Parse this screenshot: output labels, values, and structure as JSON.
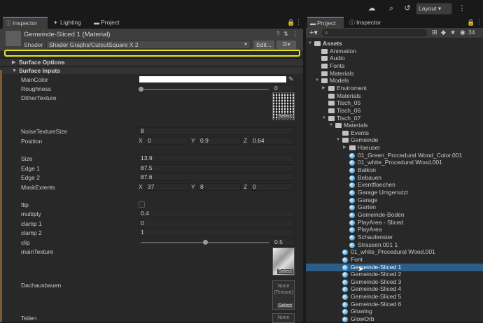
{
  "topbar": {
    "icons": [
      "cloud-icon",
      "search-icon",
      "history-icon"
    ],
    "layout_label": "Layout ▾",
    "more_icon": "more-icon"
  },
  "left": {
    "tabs": [
      {
        "label": "Inspector",
        "icon": "info-icon",
        "active": true
      },
      {
        "label": "Lighting",
        "icon": "bulb-icon",
        "active": false
      },
      {
        "label": "Project",
        "icon": "folder-icon",
        "active": false
      }
    ],
    "material_title": "Gemeinde-Sliced 1 (Material)",
    "shader_label": "Shader",
    "shader_value": "Shader Graphs/CutoutSquare X 2",
    "edit_label": "Edit...",
    "sections": {
      "surface_options": "Surface Options",
      "surface_inputs": "Surface Inputs"
    },
    "props": {
      "main_color": "MainColor",
      "roughness": "Roughness",
      "roughness_value": "0",
      "roughness_level": 0,
      "dither_texture": "DitherTexture",
      "select": "Select",
      "noise_texture_size": "NoiseTextureSize",
      "noise_texture_size_value": "8",
      "position": "Position",
      "position_x": "0",
      "position_y": "0.9",
      "position_z": "0.64",
      "size": "Size",
      "size_value": "13.9",
      "edge1": "Edge 1",
      "edge1_value": "87.5",
      "edge2": "Edge 2",
      "edge2_value": "87.6",
      "mask_extents": "MaskExtents",
      "mask_x": "37",
      "mask_y": "8",
      "mask_z": "0",
      "flip": "flip",
      "multiply": "multiply",
      "multiply_value": "0.4",
      "clamp1": "clamp 1",
      "clamp1_value": "0",
      "clamp2": "clamp 2",
      "clamp2_value": "1",
      "clip": "clip",
      "clip_value": "0.5",
      "clip_level": 0.5,
      "main_texture": "mainTexture",
      "dachausbauen": "Dachausbauen",
      "none_texture": "None\n(Texture)",
      "teilen": "Teilen",
      "none_short": "None"
    },
    "axes": {
      "x": "X",
      "y": "Y",
      "z": "Z"
    }
  },
  "right": {
    "tabs": [
      {
        "label": "Project",
        "icon": "folder-icon",
        "active": true
      },
      {
        "label": "Inspector",
        "icon": "info-icon",
        "active": false
      }
    ],
    "hidden_count": "34",
    "tree": [
      {
        "label": "Assets",
        "type": "folder",
        "depth": 0,
        "open": true,
        "bold": true
      },
      {
        "label": "Animation",
        "type": "folder",
        "depth": 1
      },
      {
        "label": "Audio",
        "type": "folder",
        "depth": 1
      },
      {
        "label": "Fonts",
        "type": "folder",
        "depth": 1
      },
      {
        "label": "Materials",
        "type": "folder",
        "depth": 1
      },
      {
        "label": "Models",
        "type": "folder",
        "depth": 1,
        "open": true
      },
      {
        "label": "Enviroment",
        "type": "folder",
        "depth": 2,
        "arrow": true
      },
      {
        "label": "Materials",
        "type": "folder",
        "depth": 2
      },
      {
        "label": "Tisch_05",
        "type": "folder",
        "depth": 2
      },
      {
        "label": "Tisch_06",
        "type": "folder",
        "depth": 2
      },
      {
        "label": "Tisch_07",
        "type": "folder",
        "depth": 2,
        "open": true
      },
      {
        "label": "Materials",
        "type": "folder",
        "depth": 3,
        "open": true
      },
      {
        "label": "Events",
        "type": "folder",
        "depth": 4
      },
      {
        "label": "Gemeinde",
        "type": "folder",
        "depth": 4,
        "open": true
      },
      {
        "label": "Haeuser",
        "type": "folder",
        "depth": 5,
        "arrow": true
      },
      {
        "label": "01_Green_Procedural Wood_Color.001",
        "type": "mat",
        "depth": 5
      },
      {
        "label": "01_white_Procedural Wood.001",
        "type": "mat",
        "depth": 5
      },
      {
        "label": "Balkon",
        "type": "mat",
        "depth": 5
      },
      {
        "label": "Bebauen",
        "type": "mat",
        "depth": 5
      },
      {
        "label": "Eventflaechen",
        "type": "mat",
        "depth": 5
      },
      {
        "label": "Garage Umgenutzt",
        "type": "mat",
        "depth": 5
      },
      {
        "label": "Garage",
        "type": "mat",
        "depth": 5
      },
      {
        "label": "Garten",
        "type": "mat",
        "depth": 5
      },
      {
        "label": "Gemeinde-Boden",
        "type": "mat",
        "depth": 5
      },
      {
        "label": "PlayArea - Sliced",
        "type": "mat",
        "depth": 5
      },
      {
        "label": "PlayArea",
        "type": "mat",
        "depth": 5
      },
      {
        "label": "Schaufenster",
        "type": "mat",
        "depth": 5
      },
      {
        "label": "Strassen.001 1",
        "type": "mat",
        "depth": 5
      },
      {
        "label": "01_white_Procedural Wood.001",
        "type": "mat",
        "depth": 4
      },
      {
        "label": "Font",
        "type": "mat",
        "depth": 4
      },
      {
        "label": "Gemeinde-Sliced 1",
        "type": "mat",
        "depth": 4,
        "selected": true
      },
      {
        "label": "Gemeinde-Sliced 2",
        "type": "mat",
        "depth": 4
      },
      {
        "label": "Gemeinde-Sliced 3",
        "type": "mat",
        "depth": 4
      },
      {
        "label": "Gemeinde-Sliced 4",
        "type": "mat",
        "depth": 4
      },
      {
        "label": "Gemeinde-Sliced 5",
        "type": "mat",
        "depth": 4
      },
      {
        "label": "Gemeinde-Sliced 6",
        "type": "mat",
        "depth": 4
      },
      {
        "label": "Glowing",
        "type": "mat",
        "depth": 4
      },
      {
        "label": "GlowOrb",
        "type": "mat",
        "depth": 4
      }
    ]
  }
}
